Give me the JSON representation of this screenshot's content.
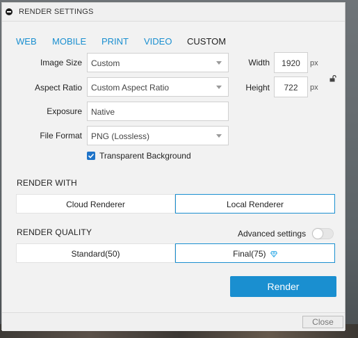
{
  "window": {
    "title": "RENDER SETTINGS"
  },
  "tabs": [
    {
      "label": "WEB"
    },
    {
      "label": "MOBILE"
    },
    {
      "label": "PRINT"
    },
    {
      "label": "VIDEO"
    },
    {
      "label": "CUSTOM"
    }
  ],
  "active_tab": "CUSTOM",
  "fields": {
    "image_size": {
      "label": "Image Size",
      "value": "Custom"
    },
    "aspect_ratio": {
      "label": "Aspect Ratio",
      "value": "Custom Aspect Ratio"
    },
    "exposure": {
      "label": "Exposure",
      "value": "Native"
    },
    "file_format": {
      "label": "File Format",
      "value": "PNG (Lossless)"
    }
  },
  "dimensions": {
    "width_label": "Width",
    "width_value": "1920",
    "height_label": "Height",
    "height_value": "722",
    "unit": "px",
    "lock_icon": "unlocked-padlock-icon"
  },
  "transparent_background": {
    "label": "Transparent Background",
    "checked": true
  },
  "render_with": {
    "heading": "RENDER WITH",
    "options": [
      "Cloud Renderer",
      "Local Renderer"
    ],
    "selected": "Local Renderer"
  },
  "render_quality": {
    "heading": "RENDER QUALITY",
    "advanced_label": "Advanced settings",
    "advanced_enabled": false,
    "options": [
      "Standard(50)",
      "Final(75)"
    ],
    "selected": "Final(75)",
    "premium_icon": "diamond-icon"
  },
  "buttons": {
    "render": "Render",
    "close": "Close"
  },
  "colors": {
    "accent": "#1a8fd0",
    "checkbox": "#1e73c8",
    "diamond": "#3aaee8"
  }
}
